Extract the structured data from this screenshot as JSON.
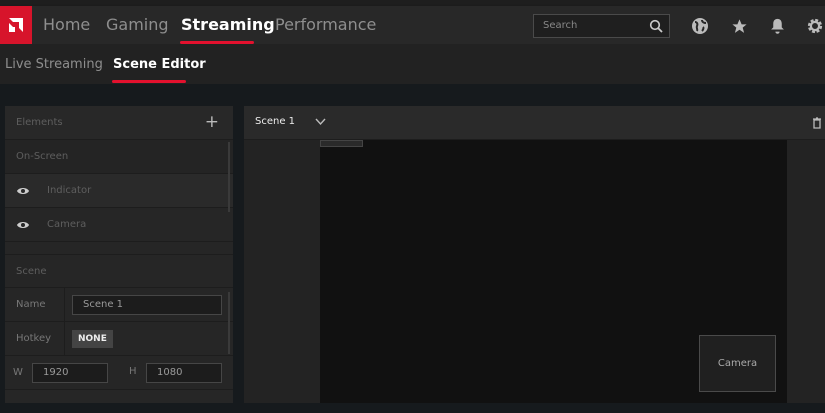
{
  "nav": {
    "items": [
      "Home",
      "Gaming",
      "Streaming",
      "Performance"
    ],
    "active": "Streaming"
  },
  "subnav": {
    "items": [
      "Live Streaming",
      "Scene Editor"
    ],
    "active": "Scene Editor"
  },
  "search": {
    "placeholder": "Search"
  },
  "colors": {
    "accent": "#e3112e",
    "logo": "#d7142b"
  },
  "elements_panel": {
    "title": "Elements",
    "add_icon": "plus-icon",
    "on_screen_label": "On-Screen",
    "items": [
      {
        "label": "Indicator",
        "icon": "eye-icon"
      },
      {
        "label": "Camera",
        "icon": "eye-icon"
      }
    ],
    "scene_label": "Scene",
    "name_label": "Name",
    "name_value": "Scene 1",
    "hotkey_label": "Hotkey",
    "hotkey_value": "NONE",
    "w_label": "W",
    "w_value": "1920",
    "h_label": "H",
    "h_value": "1080"
  },
  "scene": {
    "selected": "Scene 1",
    "camera_label": "Camera"
  }
}
